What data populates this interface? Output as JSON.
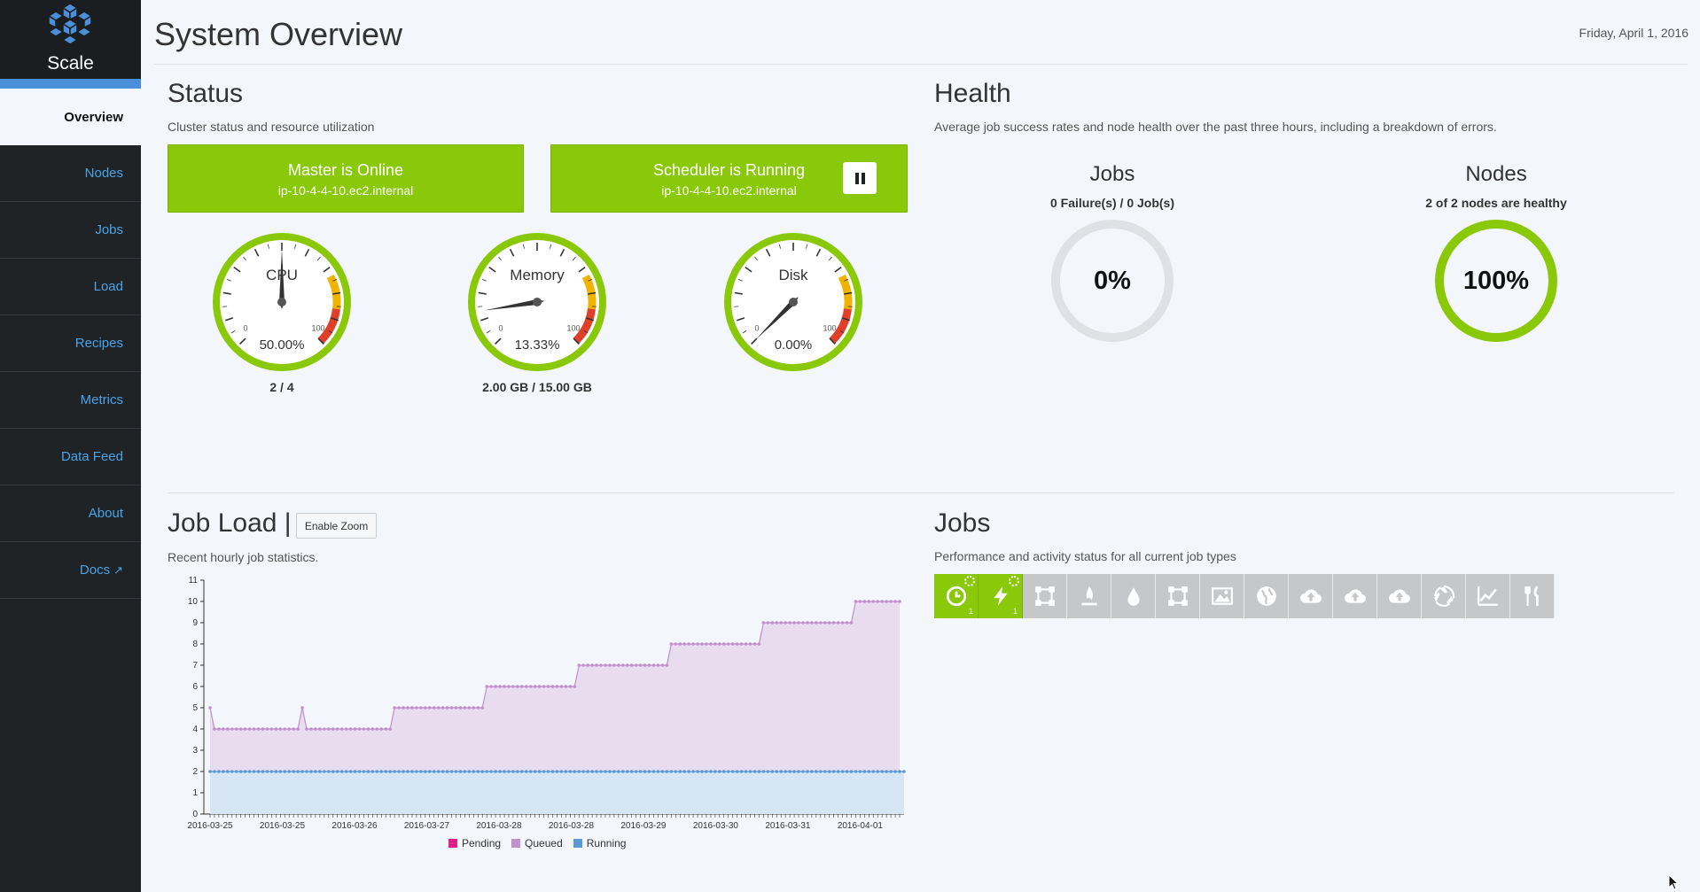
{
  "app": {
    "name": "Scale"
  },
  "sidebar": {
    "items": [
      {
        "label": "Overview"
      },
      {
        "label": "Nodes"
      },
      {
        "label": "Jobs"
      },
      {
        "label": "Load"
      },
      {
        "label": "Recipes"
      },
      {
        "label": "Metrics"
      },
      {
        "label": "Data Feed"
      },
      {
        "label": "About"
      },
      {
        "label": "Docs"
      }
    ]
  },
  "header": {
    "title": "System Overview",
    "date": "Friday, April 1, 2016"
  },
  "status": {
    "title": "Status",
    "subtitle": "Cluster status and resource utilization",
    "master": {
      "title": "Master is Online",
      "host": "ip-10-4-4-10.ec2.internal"
    },
    "scheduler": {
      "title": "Scheduler is Running",
      "host": "ip-10-4-4-10.ec2.internal"
    },
    "gauges": [
      {
        "label": "CPU",
        "value": 50.0,
        "value_text": "50.00%",
        "caption": "2 / 4",
        "min": "0",
        "max": "100"
      },
      {
        "label": "Memory",
        "value": 13.33,
        "value_text": "13.33%",
        "caption": "2.00 GB / 15.00 GB",
        "min": "0",
        "max": "100"
      },
      {
        "label": "Disk",
        "value": 0.0,
        "value_text": "0.00%",
        "caption": "",
        "min": "0",
        "max": "100"
      }
    ]
  },
  "health": {
    "title": "Health",
    "subtitle": "Average job success rates and node health over the past three hours, including a breakdown of errors.",
    "jobs": {
      "title": "Jobs",
      "summary": "0 Failure(s) / 0 Job(s)",
      "percent": "0%"
    },
    "nodes": {
      "title": "Nodes",
      "summary": "2 of 2 nodes are healthy",
      "percent": "100%"
    }
  },
  "job_load": {
    "title": "Job Load |",
    "zoom_label": "Enable Zoom",
    "subtitle": "Recent hourly job statistics."
  },
  "jobs_panel": {
    "title": "Jobs",
    "subtitle": "Performance and activity status for all current job types",
    "types": [
      {
        "icon": "clock-icon",
        "active": true,
        "count": "1"
      },
      {
        "icon": "bolt-icon",
        "active": true,
        "count": "1"
      },
      {
        "icon": "vector-square-icon",
        "active": false,
        "count": ""
      },
      {
        "icon": "flame-icon",
        "active": false,
        "count": ""
      },
      {
        "icon": "drop-icon",
        "active": false,
        "count": ""
      },
      {
        "icon": "vector-square-icon",
        "active": false,
        "count": ""
      },
      {
        "icon": "image-icon",
        "active": false,
        "count": ""
      },
      {
        "icon": "globe-icon",
        "active": false,
        "count": ""
      },
      {
        "icon": "cloud-upload-icon",
        "active": false,
        "count": ""
      },
      {
        "icon": "cloud-upload-icon",
        "active": false,
        "count": ""
      },
      {
        "icon": "cloud-upload-icon",
        "active": false,
        "count": ""
      },
      {
        "icon": "recycle-icon",
        "active": false,
        "count": ""
      },
      {
        "icon": "line-chart-icon",
        "active": false,
        "count": ""
      },
      {
        "icon": "cutlery-icon",
        "active": false,
        "count": ""
      }
    ]
  },
  "chart_data": {
    "type": "area",
    "ylim": [
      0,
      11
    ],
    "yticks": [
      0,
      1,
      2,
      3,
      4,
      5,
      6,
      7,
      8,
      9,
      10,
      11
    ],
    "x_tick_labels": [
      "2016-03-25",
      "2016-03-25",
      "2016-03-26",
      "2016-03-27",
      "2016-03-28",
      "2016-03-28",
      "2016-03-29",
      "2016-03-30",
      "2016-03-31",
      "2016-04-01"
    ],
    "series": [
      {
        "name": "Pending",
        "color": "#e0218a",
        "values": [
          0,
          0,
          0,
          0,
          0,
          0,
          0,
          0,
          0,
          0,
          0,
          0,
          0,
          0,
          0,
          0,
          0,
          0,
          0,
          0,
          0,
          0,
          0,
          0,
          0,
          0,
          0,
          0,
          0,
          0,
          0,
          0,
          0,
          0,
          0,
          0,
          0,
          0,
          0,
          0,
          0,
          0,
          0,
          0,
          0,
          0,
          0,
          0,
          0,
          0,
          0,
          0,
          0,
          0,
          0,
          0,
          0,
          0,
          0,
          0,
          0,
          0,
          0,
          0,
          0,
          0,
          0,
          0,
          0,
          0,
          0,
          0,
          0,
          0,
          0,
          0,
          0,
          0,
          0,
          0,
          0,
          0,
          0,
          0,
          0,
          0,
          0,
          0,
          0,
          0,
          0,
          0,
          0,
          0,
          0,
          0,
          0,
          0,
          0,
          0,
          0,
          0,
          0,
          0,
          0,
          0,
          0,
          0,
          0,
          0,
          0,
          0,
          0,
          0,
          0,
          0,
          0,
          0,
          0,
          0,
          0,
          0,
          0,
          0,
          0,
          0,
          0,
          0,
          0,
          0,
          0,
          0,
          0,
          0,
          0,
          0,
          0,
          0,
          0,
          0,
          0,
          0,
          0,
          0,
          0,
          0,
          0,
          0,
          0,
          0,
          0,
          0,
          0,
          0,
          0,
          0,
          0,
          0,
          0,
          0,
          0,
          0,
          0,
          0,
          0,
          0,
          0,
          0,
          0,
          0,
          0
        ]
      },
      {
        "name": "Queued",
        "color": "#c38fcf",
        "values": [
          5,
          4,
          4,
          4,
          4,
          4,
          4,
          4,
          4,
          4,
          4,
          4,
          4,
          4,
          4,
          4,
          4,
          4,
          4,
          4,
          4,
          5,
          4,
          4,
          4,
          4,
          4,
          4,
          4,
          4,
          4,
          4,
          4,
          4,
          4,
          4,
          4,
          4,
          4,
          4,
          4,
          4,
          5,
          5,
          5,
          5,
          5,
          5,
          5,
          5,
          5,
          5,
          5,
          5,
          5,
          5,
          5,
          5,
          5,
          5,
          5,
          5,
          5,
          6,
          6,
          6,
          6,
          6,
          6,
          6,
          6,
          6,
          6,
          6,
          6,
          6,
          6,
          6,
          6,
          6,
          6,
          6,
          6,
          6,
          7,
          7,
          7,
          7,
          7,
          7,
          7,
          7,
          7,
          7,
          7,
          7,
          7,
          7,
          7,
          7,
          7,
          7,
          7,
          7,
          7,
          8,
          8,
          8,
          8,
          8,
          8,
          8,
          8,
          8,
          8,
          8,
          8,
          8,
          8,
          8,
          8,
          8,
          8,
          8,
          8,
          8,
          9,
          9,
          9,
          9,
          9,
          9,
          9,
          9,
          9,
          9,
          9,
          9,
          9,
          9,
          9,
          9,
          9,
          9,
          9,
          9,
          9,
          10,
          10,
          10,
          10,
          10,
          10,
          10,
          10,
          10,
          10,
          10
        ]
      },
      {
        "name": "Running",
        "color": "#5b9bd5",
        "values": [
          2,
          2,
          2,
          2,
          2,
          2,
          2,
          2,
          2,
          2,
          2,
          2,
          2,
          2,
          2,
          2,
          2,
          2,
          2,
          2,
          2,
          2,
          2,
          2,
          2,
          2,
          2,
          2,
          2,
          2,
          2,
          2,
          2,
          2,
          2,
          2,
          2,
          2,
          2,
          2,
          2,
          2,
          2,
          2,
          2,
          2,
          2,
          2,
          2,
          2,
          2,
          2,
          2,
          2,
          2,
          2,
          2,
          2,
          2,
          2,
          2,
          2,
          2,
          2,
          2,
          2,
          2,
          2,
          2,
          2,
          2,
          2,
          2,
          2,
          2,
          2,
          2,
          2,
          2,
          2,
          2,
          2,
          2,
          2,
          2,
          2,
          2,
          2,
          2,
          2,
          2,
          2,
          2,
          2,
          2,
          2,
          2,
          2,
          2,
          2,
          2,
          2,
          2,
          2,
          2,
          2,
          2,
          2,
          2,
          2,
          2,
          2,
          2,
          2,
          2,
          2,
          2,
          2,
          2,
          2,
          2,
          2,
          2,
          2,
          2,
          2,
          2,
          2,
          2,
          2,
          2,
          2,
          2,
          2,
          2,
          2,
          2,
          2,
          2,
          2,
          2,
          2,
          2,
          2,
          2,
          2,
          2,
          2,
          2,
          2,
          2,
          2,
          2,
          2,
          2,
          2,
          2,
          2,
          2
        ]
      }
    ],
    "legend": "bottom-center",
    "grid": false
  }
}
